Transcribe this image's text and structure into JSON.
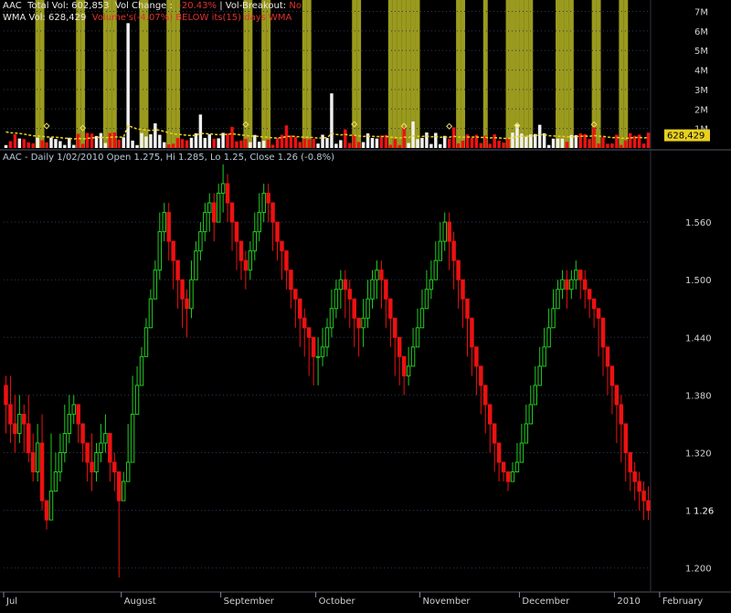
{
  "header": {
    "line1": {
      "symbol": "AAC",
      "total_vol_label": "Total Vol: 602,853",
      "vol_change_label": "Vol Change :",
      "vol_change_value": "-20.43%",
      "separator": "|",
      "breakout_label": "Vol-Breakout:",
      "breakout_value": "No"
    },
    "line2": {
      "wma_label": "WMA Vol: 628,429",
      "note": "Volume's(-4.07%) BELOW its(15) days WMA"
    },
    "price_title": "AAC - Daily 1/02/2010 Open 1.275, Hi 1.285, Lo 1.25, Close 1.26 (-0.8%)"
  },
  "colors": {
    "background": "#000000",
    "up": "#22cc22",
    "down": "#ee1111",
    "highlight_band": "#9a9a1e",
    "wma_line": "#e8d020",
    "grid": "#2a3a5a",
    "axis_text": "#d0d0d0",
    "label_text": "#b8c8d8"
  },
  "chart_data": [
    {
      "type": "bar",
      "panel": "volume",
      "title": "",
      "y_tick_labels": [
        "1M",
        "2M",
        "3M",
        "4M",
        "5M",
        "6M",
        "7M"
      ],
      "ylim": [
        0,
        7400000
      ],
      "current_value_label": "628,429",
      "current_value": 628429,
      "series": [
        {
          "name": "WMA Vol",
          "type": "line"
        }
      ],
      "highlight_band_days": [
        7,
        8,
        16,
        17,
        22,
        23,
        24,
        30,
        31,
        36,
        37,
        38,
        53,
        54,
        57,
        58,
        66,
        67,
        77,
        78,
        85,
        86,
        87,
        88,
        89,
        90,
        91,
        100,
        101,
        106,
        111,
        112,
        113,
        114,
        115,
        116,
        122,
        123,
        124,
        125,
        130,
        131,
        136,
        137
      ]
    },
    {
      "type": "candlestick",
      "panel": "price",
      "title": "AAC - Daily 1/02/2010 Open 1.275, Hi 1.285, Lo 1.25, Close 1.26 (-0.8%)",
      "y_tick_labels": [
        "1.200",
        "1.260",
        "1.320",
        "1.380",
        "1.440",
        "1.500",
        "1.560"
      ],
      "ylim": [
        1.175,
        1.62
      ],
      "last_close_label": "1.26",
      "last_close": 1.26,
      "x_tick_labels": [
        "Jul",
        "August",
        "September",
        "October",
        "November",
        "December",
        "2010",
        "February"
      ],
      "grid": true,
      "closes": [
        1.37,
        1.35,
        1.34,
        1.36,
        1.35,
        1.32,
        1.3,
        1.33,
        1.27,
        1.25,
        1.28,
        1.3,
        1.32,
        1.34,
        1.36,
        1.37,
        1.35,
        1.33,
        1.31,
        1.3,
        1.32,
        1.33,
        1.34,
        1.31,
        1.3,
        1.27,
        1.29,
        1.31,
        1.36,
        1.39,
        1.42,
        1.45,
        1.48,
        1.51,
        1.55,
        1.57,
        1.54,
        1.52,
        1.5,
        1.48,
        1.47,
        1.5,
        1.53,
        1.55,
        1.57,
        1.58,
        1.56,
        1.59,
        1.6,
        1.58,
        1.56,
        1.54,
        1.52,
        1.51,
        1.53,
        1.55,
        1.57,
        1.59,
        1.58,
        1.56,
        1.54,
        1.53,
        1.51,
        1.49,
        1.48,
        1.46,
        1.45,
        1.44,
        1.42,
        1.42,
        1.43,
        1.45,
        1.47,
        1.49,
        1.5,
        1.49,
        1.48,
        1.46,
        1.45,
        1.46,
        1.48,
        1.5,
        1.51,
        1.5,
        1.48,
        1.46,
        1.44,
        1.42,
        1.4,
        1.41,
        1.43,
        1.45,
        1.47,
        1.49,
        1.5,
        1.52,
        1.54,
        1.56,
        1.54,
        1.52,
        1.5,
        1.48,
        1.46,
        1.43,
        1.41,
        1.39,
        1.37,
        1.35,
        1.33,
        1.31,
        1.3,
        1.29,
        1.3,
        1.31,
        1.33,
        1.35,
        1.37,
        1.39,
        1.41,
        1.43,
        1.45,
        1.47,
        1.49,
        1.5,
        1.49,
        1.5,
        1.51,
        1.5,
        1.49,
        1.48,
        1.47,
        1.46,
        1.43,
        1.41,
        1.39,
        1.37,
        1.35,
        1.32,
        1.3,
        1.29,
        1.28,
        1.27,
        1.26
      ],
      "highs": [
        1.4,
        1.4,
        1.38,
        1.38,
        1.37,
        1.38,
        1.34,
        1.35,
        1.36,
        1.26,
        1.34,
        1.32,
        1.34,
        1.37,
        1.38,
        1.38,
        1.36,
        1.35,
        1.32,
        1.34,
        1.33,
        1.35,
        1.36,
        1.33,
        1.32,
        1.3,
        1.3,
        1.35,
        1.4,
        1.41,
        1.43,
        1.46,
        1.49,
        1.52,
        1.57,
        1.58,
        1.58,
        1.53,
        1.51,
        1.5,
        1.49,
        1.52,
        1.54,
        1.56,
        1.58,
        1.59,
        1.59,
        1.6,
        1.62,
        1.61,
        1.57,
        1.55,
        1.54,
        1.53,
        1.54,
        1.57,
        1.59,
        1.6,
        1.6,
        1.58,
        1.55,
        1.54,
        1.53,
        1.51,
        1.49,
        1.47,
        1.47,
        1.45,
        1.44,
        1.44,
        1.45,
        1.46,
        1.49,
        1.5,
        1.51,
        1.51,
        1.5,
        1.47,
        1.46,
        1.48,
        1.5,
        1.51,
        1.52,
        1.52,
        1.5,
        1.47,
        1.46,
        1.43,
        1.41,
        1.43,
        1.45,
        1.47,
        1.49,
        1.51,
        1.52,
        1.54,
        1.56,
        1.57,
        1.57,
        1.55,
        1.52,
        1.5,
        1.48,
        1.46,
        1.43,
        1.41,
        1.39,
        1.37,
        1.35,
        1.33,
        1.31,
        1.3,
        1.31,
        1.33,
        1.35,
        1.37,
        1.39,
        1.41,
        1.43,
        1.45,
        1.47,
        1.49,
        1.5,
        1.51,
        1.51,
        1.51,
        1.52,
        1.51,
        1.51,
        1.49,
        1.48,
        1.47,
        1.46,
        1.43,
        1.41,
        1.39,
        1.38,
        1.35,
        1.32,
        1.31,
        1.3,
        1.29,
        1.285
      ],
      "lows": [
        1.34,
        1.33,
        1.32,
        1.33,
        1.32,
        1.31,
        1.29,
        1.29,
        1.26,
        1.24,
        1.25,
        1.28,
        1.29,
        1.31,
        1.33,
        1.35,
        1.33,
        1.31,
        1.29,
        1.28,
        1.29,
        1.31,
        1.32,
        1.29,
        1.28,
        1.19,
        1.27,
        1.29,
        1.31,
        1.37,
        1.39,
        1.42,
        1.45,
        1.48,
        1.5,
        1.54,
        1.52,
        1.49,
        1.47,
        1.45,
        1.44,
        1.46,
        1.5,
        1.52,
        1.54,
        1.55,
        1.54,
        1.56,
        1.57,
        1.56,
        1.53,
        1.51,
        1.5,
        1.49,
        1.5,
        1.52,
        1.54,
        1.56,
        1.56,
        1.53,
        1.52,
        1.5,
        1.49,
        1.47,
        1.45,
        1.43,
        1.42,
        1.4,
        1.39,
        1.39,
        1.41,
        1.42,
        1.44,
        1.46,
        1.47,
        1.46,
        1.45,
        1.43,
        1.42,
        1.43,
        1.45,
        1.47,
        1.48,
        1.47,
        1.45,
        1.43,
        1.4,
        1.39,
        1.38,
        1.39,
        1.41,
        1.43,
        1.45,
        1.47,
        1.48,
        1.5,
        1.52,
        1.53,
        1.51,
        1.49,
        1.47,
        1.45,
        1.42,
        1.4,
        1.38,
        1.36,
        1.34,
        1.32,
        1.3,
        1.29,
        1.29,
        1.28,
        1.29,
        1.3,
        1.32,
        1.33,
        1.35,
        1.37,
        1.39,
        1.41,
        1.44,
        1.45,
        1.47,
        1.48,
        1.47,
        1.48,
        1.49,
        1.48,
        1.47,
        1.46,
        1.45,
        1.42,
        1.4,
        1.38,
        1.36,
        1.33,
        1.31,
        1.29,
        1.28,
        1.27,
        1.26,
        1.25,
        1.25
      ]
    }
  ]
}
